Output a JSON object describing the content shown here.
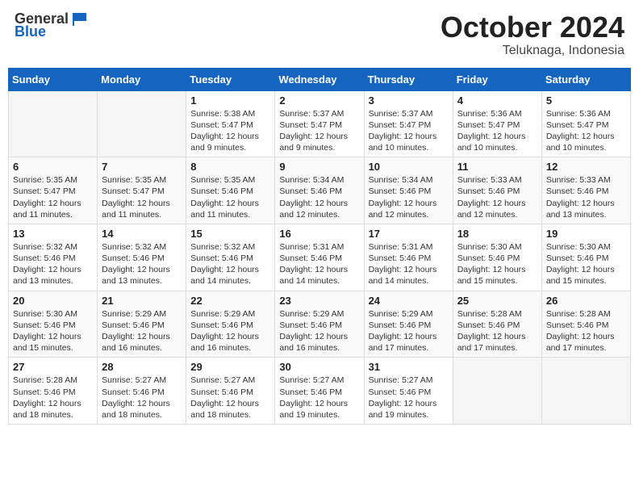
{
  "header": {
    "logo_general": "General",
    "logo_blue": "Blue",
    "month": "October 2024",
    "location": "Teluknaga, Indonesia"
  },
  "days_of_week": [
    "Sunday",
    "Monday",
    "Tuesday",
    "Wednesday",
    "Thursday",
    "Friday",
    "Saturday"
  ],
  "weeks": [
    [
      {
        "day": "",
        "sunrise": "",
        "sunset": "",
        "daylight": ""
      },
      {
        "day": "",
        "sunrise": "",
        "sunset": "",
        "daylight": ""
      },
      {
        "day": "1",
        "sunrise": "Sunrise: 5:38 AM",
        "sunset": "Sunset: 5:47 PM",
        "daylight": "Daylight: 12 hours and 9 minutes."
      },
      {
        "day": "2",
        "sunrise": "Sunrise: 5:37 AM",
        "sunset": "Sunset: 5:47 PM",
        "daylight": "Daylight: 12 hours and 9 minutes."
      },
      {
        "day": "3",
        "sunrise": "Sunrise: 5:37 AM",
        "sunset": "Sunset: 5:47 PM",
        "daylight": "Daylight: 12 hours and 10 minutes."
      },
      {
        "day": "4",
        "sunrise": "Sunrise: 5:36 AM",
        "sunset": "Sunset: 5:47 PM",
        "daylight": "Daylight: 12 hours and 10 minutes."
      },
      {
        "day": "5",
        "sunrise": "Sunrise: 5:36 AM",
        "sunset": "Sunset: 5:47 PM",
        "daylight": "Daylight: 12 hours and 10 minutes."
      }
    ],
    [
      {
        "day": "6",
        "sunrise": "Sunrise: 5:35 AM",
        "sunset": "Sunset: 5:47 PM",
        "daylight": "Daylight: 12 hours and 11 minutes."
      },
      {
        "day": "7",
        "sunrise": "Sunrise: 5:35 AM",
        "sunset": "Sunset: 5:47 PM",
        "daylight": "Daylight: 12 hours and 11 minutes."
      },
      {
        "day": "8",
        "sunrise": "Sunrise: 5:35 AM",
        "sunset": "Sunset: 5:46 PM",
        "daylight": "Daylight: 12 hours and 11 minutes."
      },
      {
        "day": "9",
        "sunrise": "Sunrise: 5:34 AM",
        "sunset": "Sunset: 5:46 PM",
        "daylight": "Daylight: 12 hours and 12 minutes."
      },
      {
        "day": "10",
        "sunrise": "Sunrise: 5:34 AM",
        "sunset": "Sunset: 5:46 PM",
        "daylight": "Daylight: 12 hours and 12 minutes."
      },
      {
        "day": "11",
        "sunrise": "Sunrise: 5:33 AM",
        "sunset": "Sunset: 5:46 PM",
        "daylight": "Daylight: 12 hours and 12 minutes."
      },
      {
        "day": "12",
        "sunrise": "Sunrise: 5:33 AM",
        "sunset": "Sunset: 5:46 PM",
        "daylight": "Daylight: 12 hours and 13 minutes."
      }
    ],
    [
      {
        "day": "13",
        "sunrise": "Sunrise: 5:32 AM",
        "sunset": "Sunset: 5:46 PM",
        "daylight": "Daylight: 12 hours and 13 minutes."
      },
      {
        "day": "14",
        "sunrise": "Sunrise: 5:32 AM",
        "sunset": "Sunset: 5:46 PM",
        "daylight": "Daylight: 12 hours and 13 minutes."
      },
      {
        "day": "15",
        "sunrise": "Sunrise: 5:32 AM",
        "sunset": "Sunset: 5:46 PM",
        "daylight": "Daylight: 12 hours and 14 minutes."
      },
      {
        "day": "16",
        "sunrise": "Sunrise: 5:31 AM",
        "sunset": "Sunset: 5:46 PM",
        "daylight": "Daylight: 12 hours and 14 minutes."
      },
      {
        "day": "17",
        "sunrise": "Sunrise: 5:31 AM",
        "sunset": "Sunset: 5:46 PM",
        "daylight": "Daylight: 12 hours and 14 minutes."
      },
      {
        "day": "18",
        "sunrise": "Sunrise: 5:30 AM",
        "sunset": "Sunset: 5:46 PM",
        "daylight": "Daylight: 12 hours and 15 minutes."
      },
      {
        "day": "19",
        "sunrise": "Sunrise: 5:30 AM",
        "sunset": "Sunset: 5:46 PM",
        "daylight": "Daylight: 12 hours and 15 minutes."
      }
    ],
    [
      {
        "day": "20",
        "sunrise": "Sunrise: 5:30 AM",
        "sunset": "Sunset: 5:46 PM",
        "daylight": "Daylight: 12 hours and 15 minutes."
      },
      {
        "day": "21",
        "sunrise": "Sunrise: 5:29 AM",
        "sunset": "Sunset: 5:46 PM",
        "daylight": "Daylight: 12 hours and 16 minutes."
      },
      {
        "day": "22",
        "sunrise": "Sunrise: 5:29 AM",
        "sunset": "Sunset: 5:46 PM",
        "daylight": "Daylight: 12 hours and 16 minutes."
      },
      {
        "day": "23",
        "sunrise": "Sunrise: 5:29 AM",
        "sunset": "Sunset: 5:46 PM",
        "daylight": "Daylight: 12 hours and 16 minutes."
      },
      {
        "day": "24",
        "sunrise": "Sunrise: 5:29 AM",
        "sunset": "Sunset: 5:46 PM",
        "daylight": "Daylight: 12 hours and 17 minutes."
      },
      {
        "day": "25",
        "sunrise": "Sunrise: 5:28 AM",
        "sunset": "Sunset: 5:46 PM",
        "daylight": "Daylight: 12 hours and 17 minutes."
      },
      {
        "day": "26",
        "sunrise": "Sunrise: 5:28 AM",
        "sunset": "Sunset: 5:46 PM",
        "daylight": "Daylight: 12 hours and 17 minutes."
      }
    ],
    [
      {
        "day": "27",
        "sunrise": "Sunrise: 5:28 AM",
        "sunset": "Sunset: 5:46 PM",
        "daylight": "Daylight: 12 hours and 18 minutes."
      },
      {
        "day": "28",
        "sunrise": "Sunrise: 5:27 AM",
        "sunset": "Sunset: 5:46 PM",
        "daylight": "Daylight: 12 hours and 18 minutes."
      },
      {
        "day": "29",
        "sunrise": "Sunrise: 5:27 AM",
        "sunset": "Sunset: 5:46 PM",
        "daylight": "Daylight: 12 hours and 18 minutes."
      },
      {
        "day": "30",
        "sunrise": "Sunrise: 5:27 AM",
        "sunset": "Sunset: 5:46 PM",
        "daylight": "Daylight: 12 hours and 19 minutes."
      },
      {
        "day": "31",
        "sunrise": "Sunrise: 5:27 AM",
        "sunset": "Sunset: 5:46 PM",
        "daylight": "Daylight: 12 hours and 19 minutes."
      },
      {
        "day": "",
        "sunrise": "",
        "sunset": "",
        "daylight": ""
      },
      {
        "day": "",
        "sunrise": "",
        "sunset": "",
        "daylight": ""
      }
    ]
  ]
}
